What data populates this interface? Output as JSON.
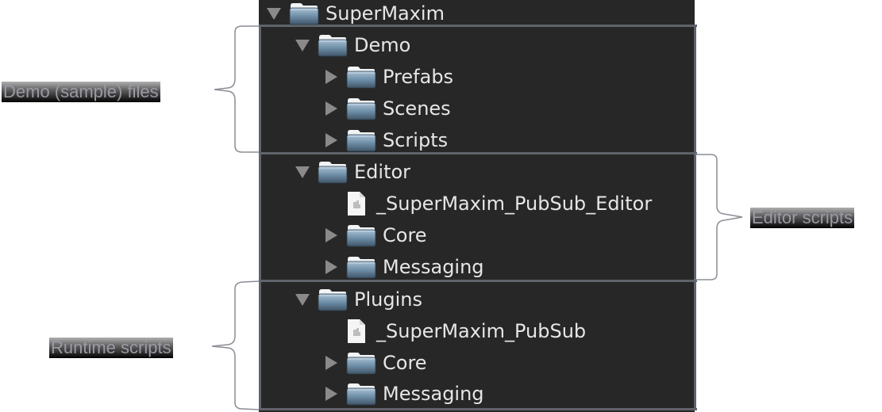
{
  "tree": {
    "root": {
      "label": "SuperMaxim",
      "expanded": true,
      "icon": "folder-icon"
    },
    "sections": [
      {
        "label": "Demo",
        "expanded": true,
        "icon": "folder-icon",
        "children": [
          {
            "label": "Prefabs",
            "type": "folder",
            "expanded": false
          },
          {
            "label": "Scenes",
            "type": "folder",
            "expanded": false
          },
          {
            "label": "Scripts",
            "type": "folder",
            "expanded": false
          }
        ]
      },
      {
        "label": "Editor",
        "expanded": true,
        "icon": "folder-icon",
        "children": [
          {
            "label": "_SuperMaxim_PubSub_Editor",
            "type": "file"
          },
          {
            "label": "Core",
            "type": "folder",
            "expanded": false
          },
          {
            "label": "Messaging",
            "type": "folder",
            "expanded": false
          }
        ]
      },
      {
        "label": "Plugins",
        "expanded": true,
        "icon": "folder-icon",
        "children": [
          {
            "label": "_SuperMaxim_PubSub",
            "type": "file"
          },
          {
            "label": "Core",
            "type": "folder",
            "expanded": false
          },
          {
            "label": "Messaging",
            "type": "folder",
            "expanded": false
          }
        ]
      }
    ]
  },
  "annotations": {
    "demo": "Demo (sample) files",
    "editor": "Editor scripts",
    "runtime": "Runtime scripts"
  },
  "colors": {
    "panel_bg": "#272727",
    "separator": "#5f636b",
    "text": "#e6e6e6",
    "triangle": "#8a8a8a",
    "folder": "#6f8fa8",
    "annotation_text": "#9a9aa6"
  }
}
